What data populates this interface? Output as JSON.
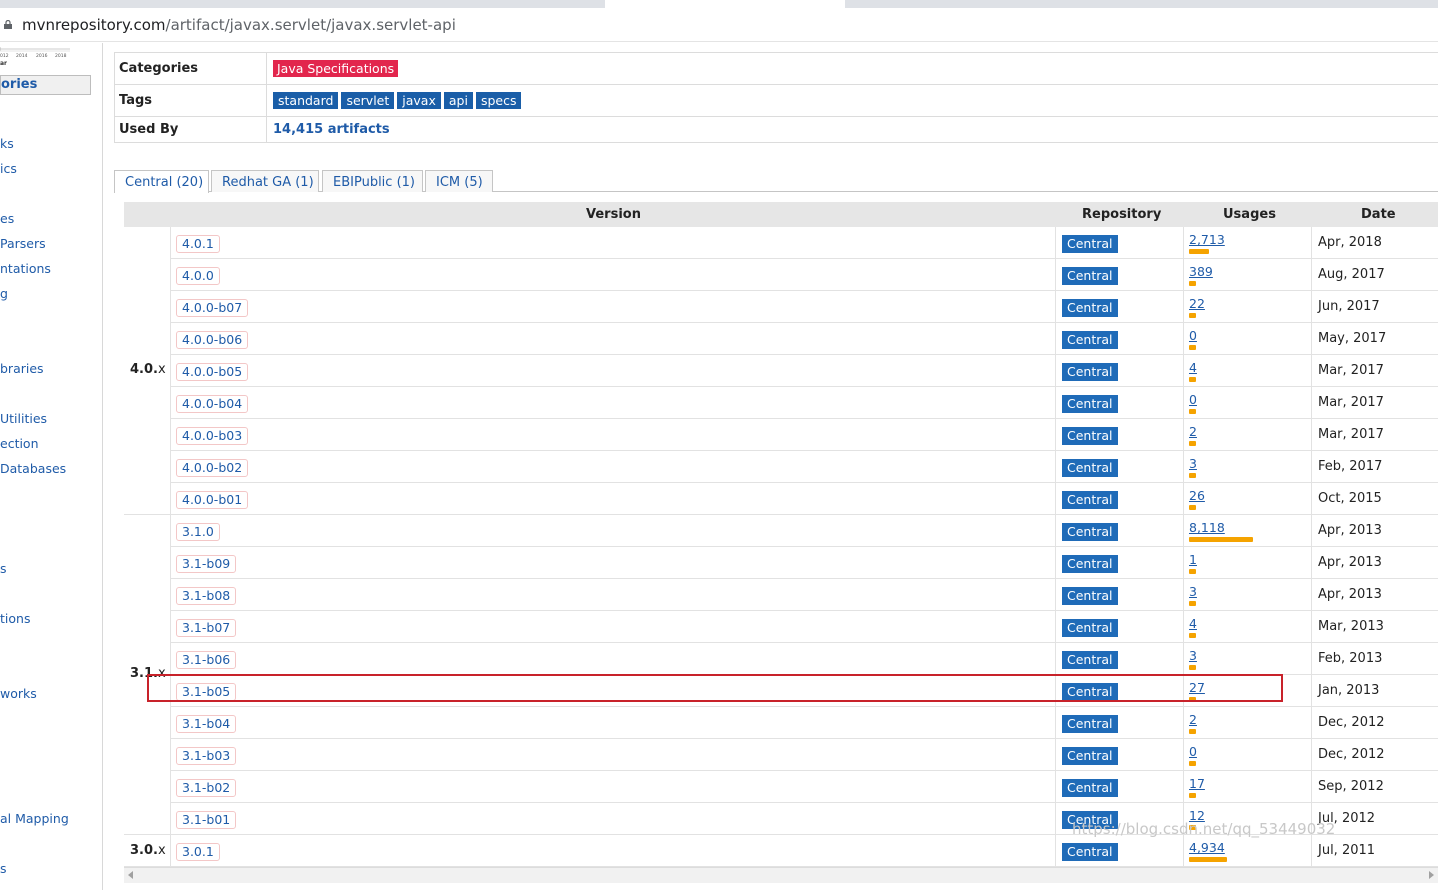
{
  "browser": {
    "url_host": "mvnrepository.com",
    "url_path": "/artifact/javax.servlet/javax.servlet-api"
  },
  "sidebar": {
    "thumb_years": [
      "012",
      "2014",
      "2016",
      "2018"
    ],
    "thumb_caption": "ar",
    "heading": "ories",
    "items": [
      "ks",
      "ics",
      "es",
      "Parsers",
      "ntations",
      "g",
      "braries",
      "Utilities",
      "ection",
      "Databases",
      "s",
      "tions",
      "works",
      "al Mapping",
      "s"
    ]
  },
  "info": {
    "categories_label": "Categories",
    "categories_value": "Java Specifications",
    "tags_label": "Tags",
    "tags": [
      "standard",
      "servlet",
      "javax",
      "api",
      "specs"
    ],
    "usedby_label": "Used By",
    "usedby_value": "14,415 artifacts"
  },
  "tabs": [
    "Central (20)",
    "Redhat GA (1)",
    "EBIPublic (1)",
    "ICM (5)"
  ],
  "table": {
    "headers": {
      "version": "Version",
      "repository": "Repository",
      "usages": "Usages",
      "date": "Date"
    },
    "groups": [
      {
        "major": "4.0.",
        "suffix": "x"
      },
      {
        "major": "3.1.",
        "suffix": "x"
      },
      {
        "major": "3.0.",
        "suffix": "x"
      }
    ],
    "rows": [
      {
        "version": "4.0.1",
        "repo": "Central",
        "usages": "2,713",
        "usage_bar": 0.32,
        "date": "Apr, 2018"
      },
      {
        "version": "4.0.0",
        "repo": "Central",
        "usages": "389",
        "usage_bar": 0.05,
        "date": "Aug, 2017"
      },
      {
        "version": "4.0.0-b07",
        "repo": "Central",
        "usages": "22",
        "usage_bar": 0.02,
        "date": "Jun, 2017"
      },
      {
        "version": "4.0.0-b06",
        "repo": "Central",
        "usages": "0",
        "usage_bar": 0.01,
        "date": "May, 2017"
      },
      {
        "version": "4.0.0-b05",
        "repo": "Central",
        "usages": "4",
        "usage_bar": 0.01,
        "date": "Mar, 2017"
      },
      {
        "version": "4.0.0-b04",
        "repo": "Central",
        "usages": "0",
        "usage_bar": 0.01,
        "date": "Mar, 2017"
      },
      {
        "version": "4.0.0-b03",
        "repo": "Central",
        "usages": "2",
        "usage_bar": 0.01,
        "date": "Mar, 2017"
      },
      {
        "version": "4.0.0-b02",
        "repo": "Central",
        "usages": "3",
        "usage_bar": 0.01,
        "date": "Feb, 2017"
      },
      {
        "version": "4.0.0-b01",
        "repo": "Central",
        "usages": "26",
        "usage_bar": 0.02,
        "date": "Oct, 2015"
      },
      {
        "version": "3.1.0",
        "repo": "Central",
        "usages": "8,118",
        "usage_bar": 1.0,
        "date": "Apr, 2013"
      },
      {
        "version": "3.1-b09",
        "repo": "Central",
        "usages": "1",
        "usage_bar": 0.01,
        "date": "Apr, 2013"
      },
      {
        "version": "3.1-b08",
        "repo": "Central",
        "usages": "3",
        "usage_bar": 0.01,
        "date": "Apr, 2013"
      },
      {
        "version": "3.1-b07",
        "repo": "Central",
        "usages": "4",
        "usage_bar": 0.01,
        "date": "Mar, 2013"
      },
      {
        "version": "3.1-b06",
        "repo": "Central",
        "usages": "3",
        "usage_bar": 0.01,
        "date": "Feb, 2013"
      },
      {
        "version": "3.1-b05",
        "repo": "Central",
        "usages": "27",
        "usage_bar": 0.02,
        "date": "Jan, 2013"
      },
      {
        "version": "3.1-b04",
        "repo": "Central",
        "usages": "2",
        "usage_bar": 0.01,
        "date": "Dec, 2012"
      },
      {
        "version": "3.1-b03",
        "repo": "Central",
        "usages": "0",
        "usage_bar": 0.01,
        "date": "Dec, 2012"
      },
      {
        "version": "3.1-b02",
        "repo": "Central",
        "usages": "17",
        "usage_bar": 0.02,
        "date": "Sep, 2012"
      },
      {
        "version": "3.1-b01",
        "repo": "Central",
        "usages": "12",
        "usage_bar": 0.02,
        "date": "Jul, 2012"
      },
      {
        "version": "3.0.1",
        "repo": "Central",
        "usages": "4,934",
        "usage_bar": 0.6,
        "date": "Jul, 2011"
      }
    ]
  },
  "watermark": "https://blog.csdn.net/qq_53449032",
  "colors": {
    "tag_red": "#e2264d",
    "tag_blue": "#1a5ea8",
    "repo_badge": "#1f6bb8",
    "usage_bar": "#f5a300",
    "highlight_box": "#c8222a",
    "link": "#1f5ba8"
  }
}
